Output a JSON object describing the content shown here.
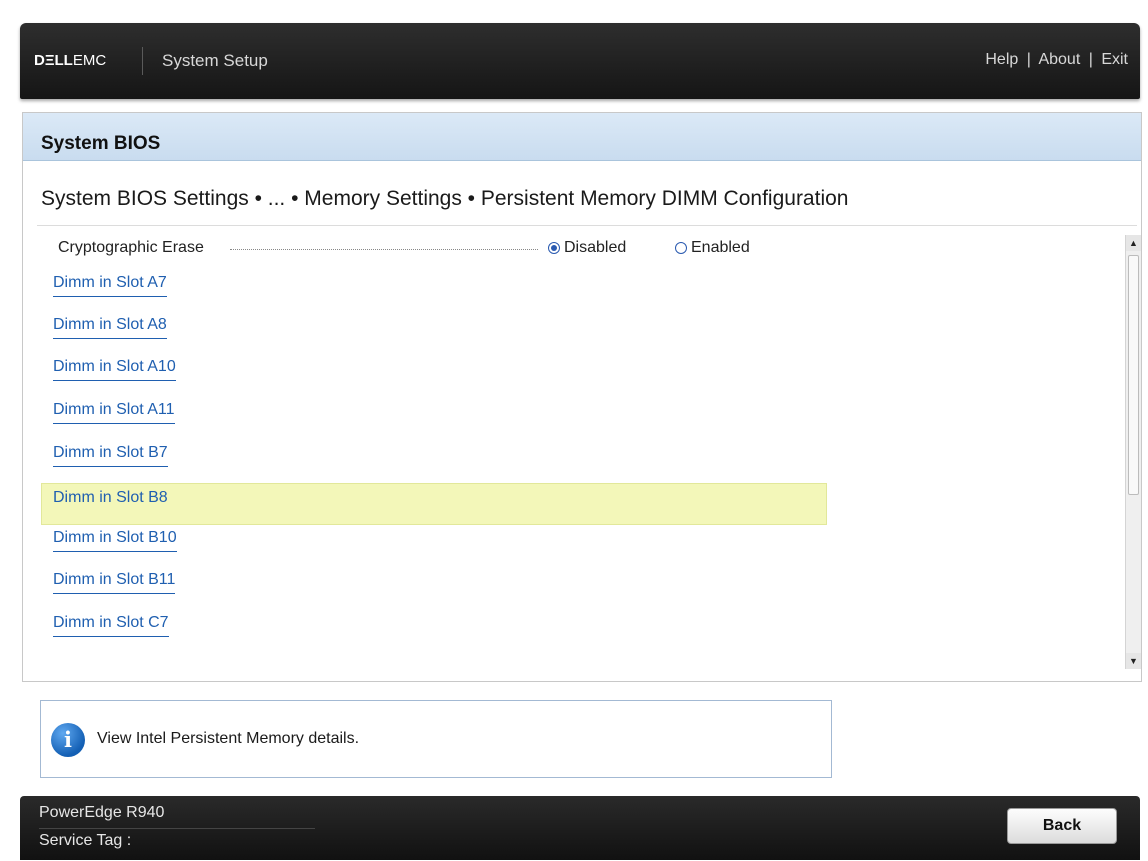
{
  "header": {
    "logo_dell": "DΞLL",
    "logo_emc": "EMC",
    "title": "System Setup",
    "help": "Help",
    "about": "About",
    "exit": "Exit",
    "separator": "|"
  },
  "panel": {
    "title": "System BIOS",
    "breadcrumb": "System BIOS Settings • ... • Memory Settings • Persistent Memory DIMM Configuration"
  },
  "setting": {
    "label": "Cryptographic Erase",
    "options": [
      "Disabled",
      "Enabled"
    ],
    "selected": "Disabled"
  },
  "dimms": [
    "Dimm in Slot A7",
    "Dimm in Slot A8",
    "Dimm in Slot A10",
    "Dimm in Slot A11",
    "Dimm in Slot B7",
    "Dimm in Slot B8",
    "Dimm in Slot B10",
    "Dimm in Slot B11",
    "Dimm in Slot C7"
  ],
  "highlighted_dimm": "Dimm in Slot B8",
  "info": {
    "text": "View Intel Persistent Memory details."
  },
  "footer": {
    "model": "PowerEdge R940",
    "service_tag_label": "Service Tag :",
    "back": "Back"
  },
  "colors": {
    "link": "#1f5fb0",
    "highlight": "#f3f7b9",
    "title_bar": "#cfe0f1"
  }
}
